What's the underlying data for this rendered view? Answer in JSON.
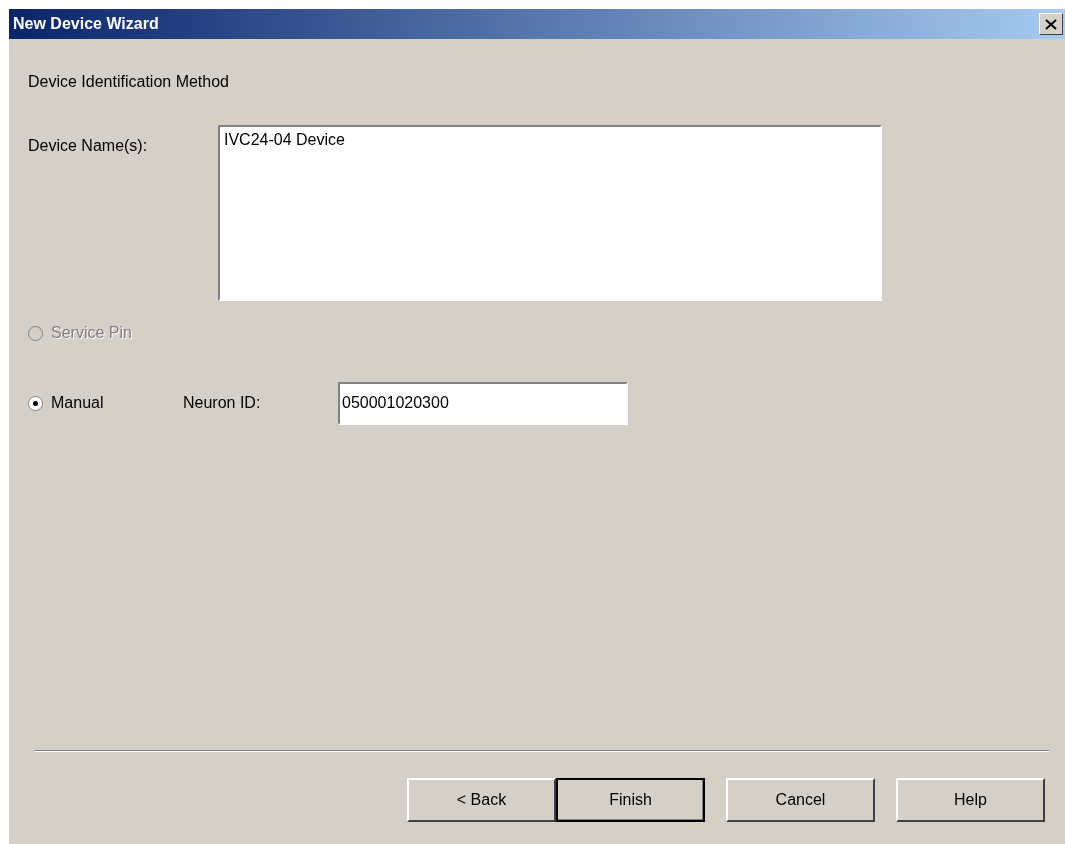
{
  "window": {
    "title": "New Device Wizard"
  },
  "heading": "Device Identification Method",
  "device_names": {
    "label": "Device Name(s):",
    "value": "IVC24-04 Device"
  },
  "options": [
    {
      "label": "Service Pin",
      "selected": false,
      "disabled": true
    },
    {
      "label": "Manual",
      "selected": true,
      "disabled": false
    }
  ],
  "neuron_id": {
    "label": "Neuron ID:",
    "value": "050001020300"
  },
  "buttons": [
    {
      "label": "< Back",
      "default": false
    },
    {
      "label": "Finish",
      "default": true
    },
    {
      "label": "Cancel",
      "default": false
    },
    {
      "label": "Help",
      "default": false
    }
  ]
}
